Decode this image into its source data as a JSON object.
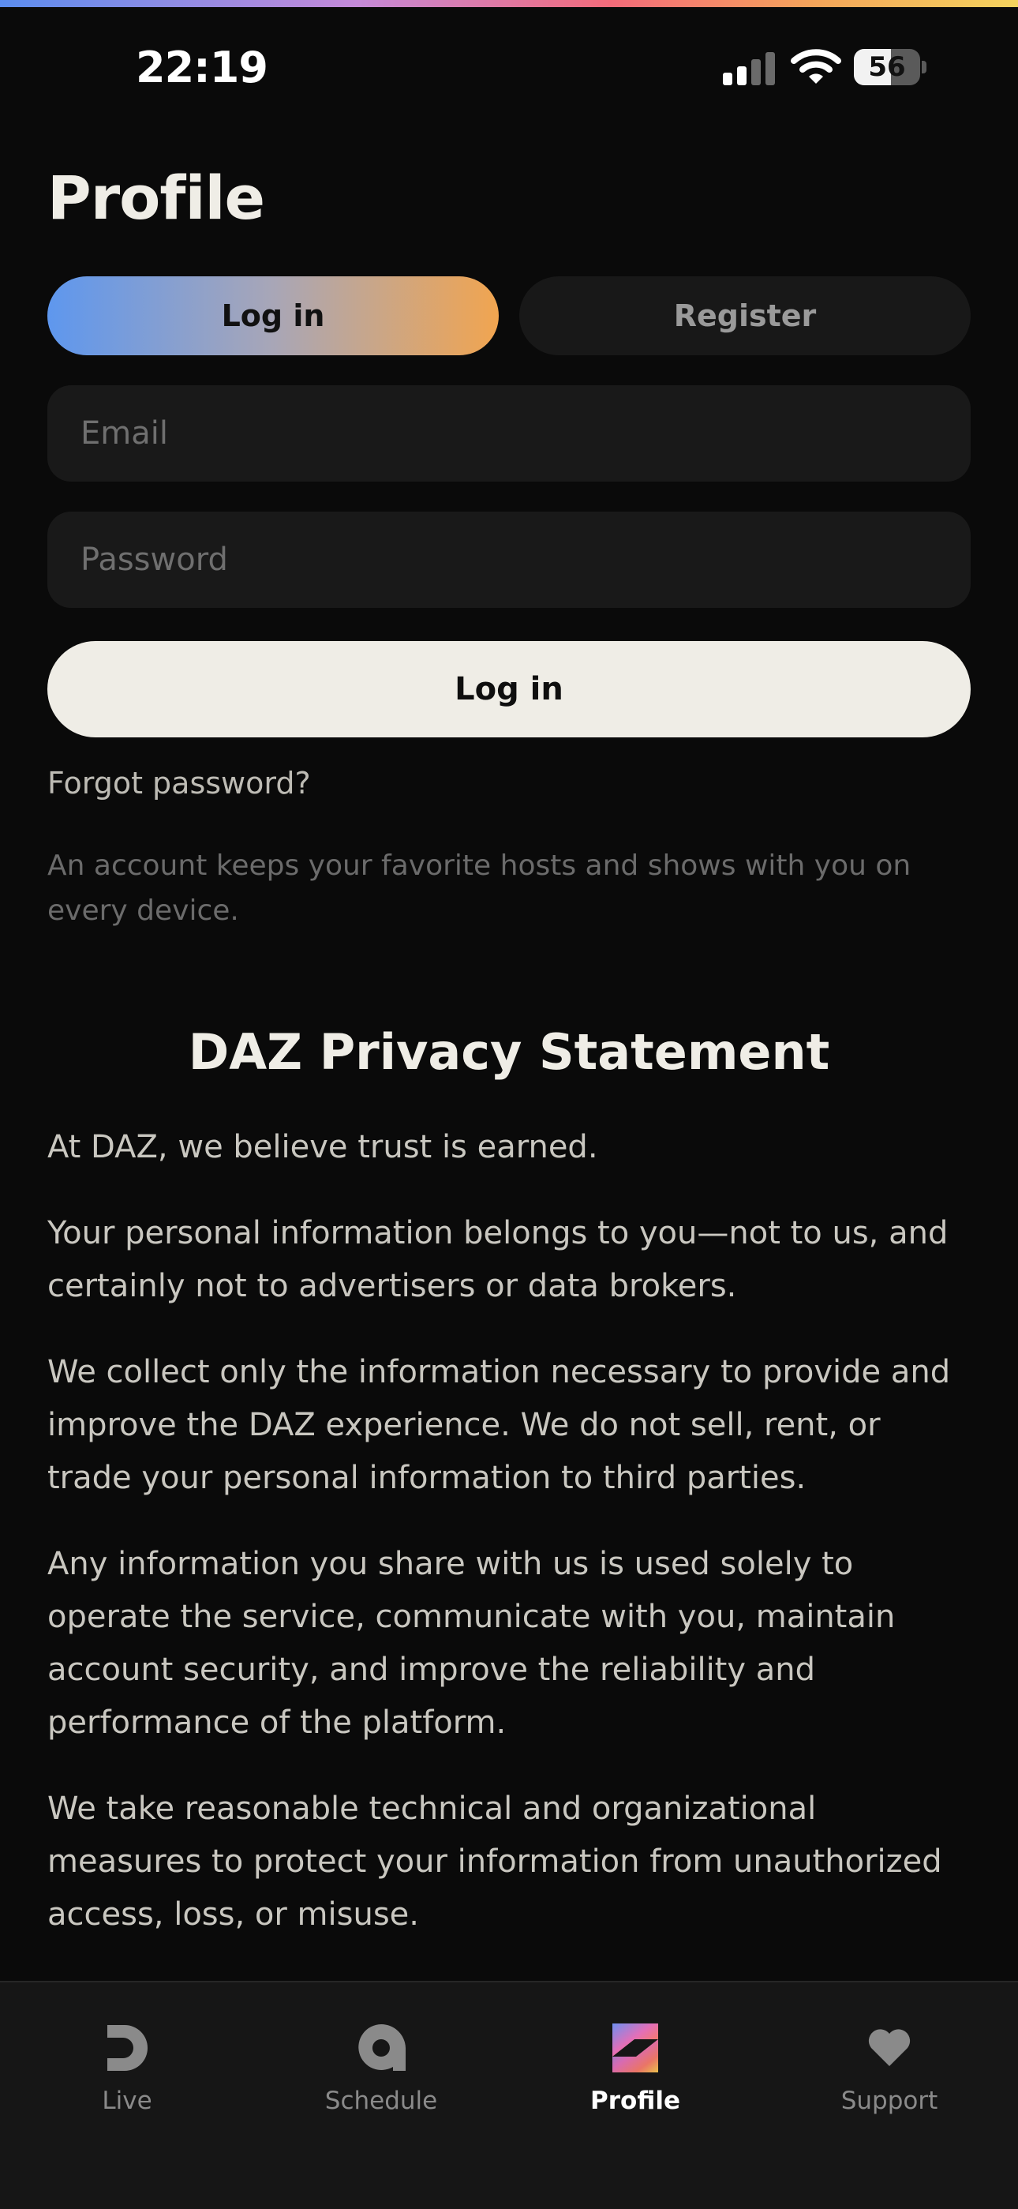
{
  "status_bar": {
    "time": "22:19",
    "battery_level": "56"
  },
  "header": {
    "title": "Profile"
  },
  "auth_tabs": {
    "login_label": "Log in",
    "register_label": "Register",
    "active": "login"
  },
  "form": {
    "email": {
      "value": "",
      "placeholder": "Email"
    },
    "password": {
      "value": "",
      "placeholder": "Password"
    },
    "submit_label": "Log in",
    "forgot_label": "Forgot password?",
    "note": "An account keeps your favorite hosts and shows with you on every device."
  },
  "privacy": {
    "title": "DAZ Privacy Statement",
    "paragraphs": [
      "At DAZ, we believe trust is earned.",
      "Your personal information belongs to you—not to us, and certainly not to advertisers or data brokers.",
      "We collect only the information necessary to provide and improve the DAZ experience. We do not sell, rent, or trade your personal information to third parties.",
      "Any information you share with us is used solely to operate the service, communicate with you, maintain account security, and improve the reliability and performance of the platform.",
      "We take reasonable technical and organizational measures to protect your information from unauthorized access, loss, or misuse."
    ]
  },
  "tab_bar": {
    "items": [
      {
        "label": "Live",
        "icon": "live-icon"
      },
      {
        "label": "Schedule",
        "icon": "schedule-icon"
      },
      {
        "label": "Profile",
        "icon": "profile-z-icon"
      },
      {
        "label": "Support",
        "icon": "heart-icon"
      }
    ],
    "active": "Profile"
  },
  "colors": {
    "background": "#0a0a0a",
    "text_primary": "#efede6",
    "gradient_start": "#5e97ee",
    "gradient_end": "#f1a550",
    "field_background": "#191919"
  }
}
